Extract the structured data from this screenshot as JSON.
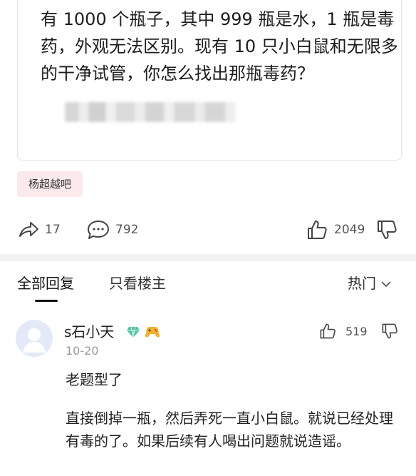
{
  "post": {
    "question": "有 1000 个瓶子，其中 999 瓶是水，1 瓶是毒药，外观无法区别。现有 10 只小白鼠和无限多的干净试管，你怎么找出那瓶毒药？",
    "tag": "杨超越吧",
    "share_count": "17",
    "comment_count": "792",
    "like_count": "2049"
  },
  "tabs": {
    "all_replies": "全部回复",
    "owner_only": "只看楼主",
    "sort_label": "热门"
  },
  "comment": {
    "username": "s石小天",
    "date": "10-20",
    "like_count": "519",
    "line1": "老题型了",
    "body": "直接倒掉一瓶，然后弄死一直小白鼠。就说已经处理有毒的了。如果后续有人喝出问题就说造谣。"
  },
  "icons": {
    "share": "share-icon",
    "comment": "comment-icon",
    "like": "thumbs-up-icon",
    "dislike": "thumbs-down-icon",
    "chevron": "chevron-down-icon",
    "gem": "gem-badge-icon",
    "game": "gamepad-badge-icon"
  },
  "colors": {
    "tag_bg": "#fbe9ec",
    "gem": "#4fc3a1",
    "game": "#f0b135",
    "divider": "#f2f2f2"
  }
}
